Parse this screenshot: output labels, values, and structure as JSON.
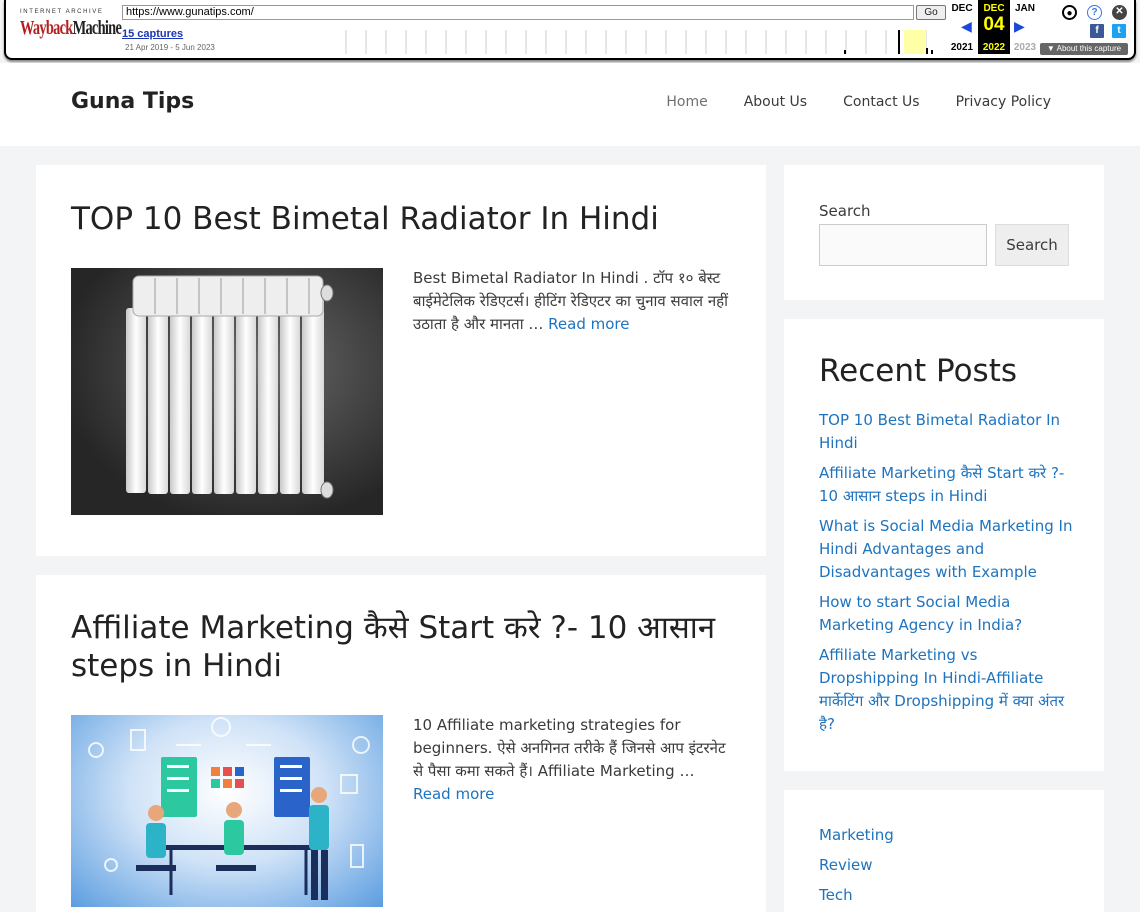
{
  "wayback": {
    "archive_label": "INTERNET ARCHIVE",
    "logo_red": "Wayback",
    "logo_dark": "Machine",
    "url": "https://www.gunatips.com/",
    "go_label": "Go",
    "captures": "15 captures",
    "date_range": "21 Apr 2019 - 5 Jun 2023",
    "prev_month": "DEC",
    "cur_month": "DEC",
    "next_month": "JAN",
    "cur_day": "04",
    "prev_year": "2021",
    "cur_year": "2022",
    "next_year": "2023",
    "about": "About this capture"
  },
  "site": {
    "title": "Guna Tips",
    "nav": [
      "Home",
      "About Us",
      "Contact Us",
      "Privacy Policy"
    ]
  },
  "posts": [
    {
      "title": "TOP 10 Best Bimetal Radiator In Hindi",
      "excerpt": "Best Bimetal Radiator In Hindi . टॉप १० बेस्ट बाईमेटेलिक रेडिएटर्स। हीटिंग रेडिएटर का चुनाव सवाल नहीं उठाता है और मानता … ",
      "read_more": "Read more"
    },
    {
      "title": "Affiliate Marketing कैसे Start करे ?- 10 आसान steps in Hindi",
      "excerpt": "10 Affiliate marketing strategies for beginners. ऐसे अनगिनत तरीके हैं जिनसे आप इंटरनेट से पैसा कमा सकते हैं। Affiliate Marketing … ",
      "read_more": "Read more"
    }
  ],
  "sidebar": {
    "search_label": "Search",
    "search_button": "Search",
    "recent_title": "Recent Posts",
    "recent_posts": [
      "TOP 10 Best Bimetal Radiator In Hindi",
      "Affiliate Marketing कैसे Start करे ?- 10 आसान steps in Hindi",
      "What is Social Media Marketing In Hindi Advantages and Disadvantages with Example",
      "How to start Social Media Marketing Agency in India?",
      "Affiliate Marketing vs Dropshipping In Hindi-Affiliate मार्केटिंग और Dropshipping में क्या अंतर है?"
    ],
    "categories": [
      "Marketing",
      "Review",
      "Tech"
    ]
  }
}
